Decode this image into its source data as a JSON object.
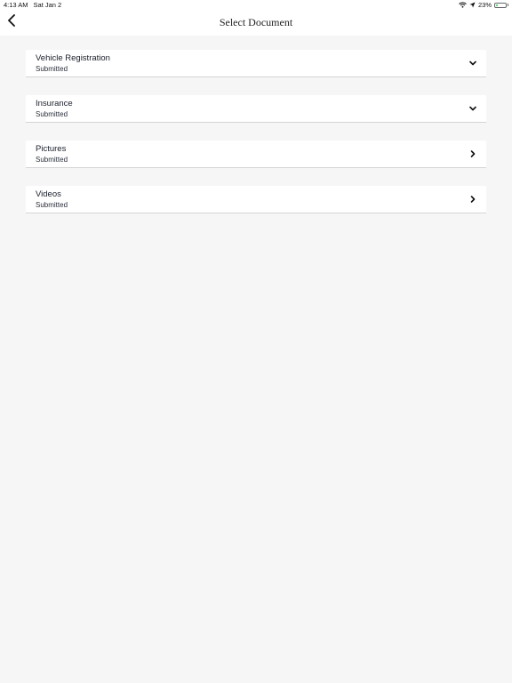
{
  "status_bar": {
    "time": "4:13 AM",
    "date": "Sat Jan 2",
    "battery_percent": "23%",
    "battery_level": 0.23,
    "icons": [
      "wifi-icon",
      "location-arrow-icon",
      "battery-icon"
    ]
  },
  "nav": {
    "title": "Select Document",
    "back_icon": "chevron-left-icon"
  },
  "documents": [
    {
      "name": "Vehicle Registration",
      "status": "Submitted",
      "icon": "chevron-down-icon"
    },
    {
      "name": "Insurance",
      "status": "Submitted",
      "icon": "chevron-down-icon"
    },
    {
      "name": "Pictures",
      "status": "Submitted",
      "icon": "chevron-right-icon"
    },
    {
      "name": "Videos",
      "status": "Submitted",
      "icon": "chevron-right-icon"
    }
  ]
}
